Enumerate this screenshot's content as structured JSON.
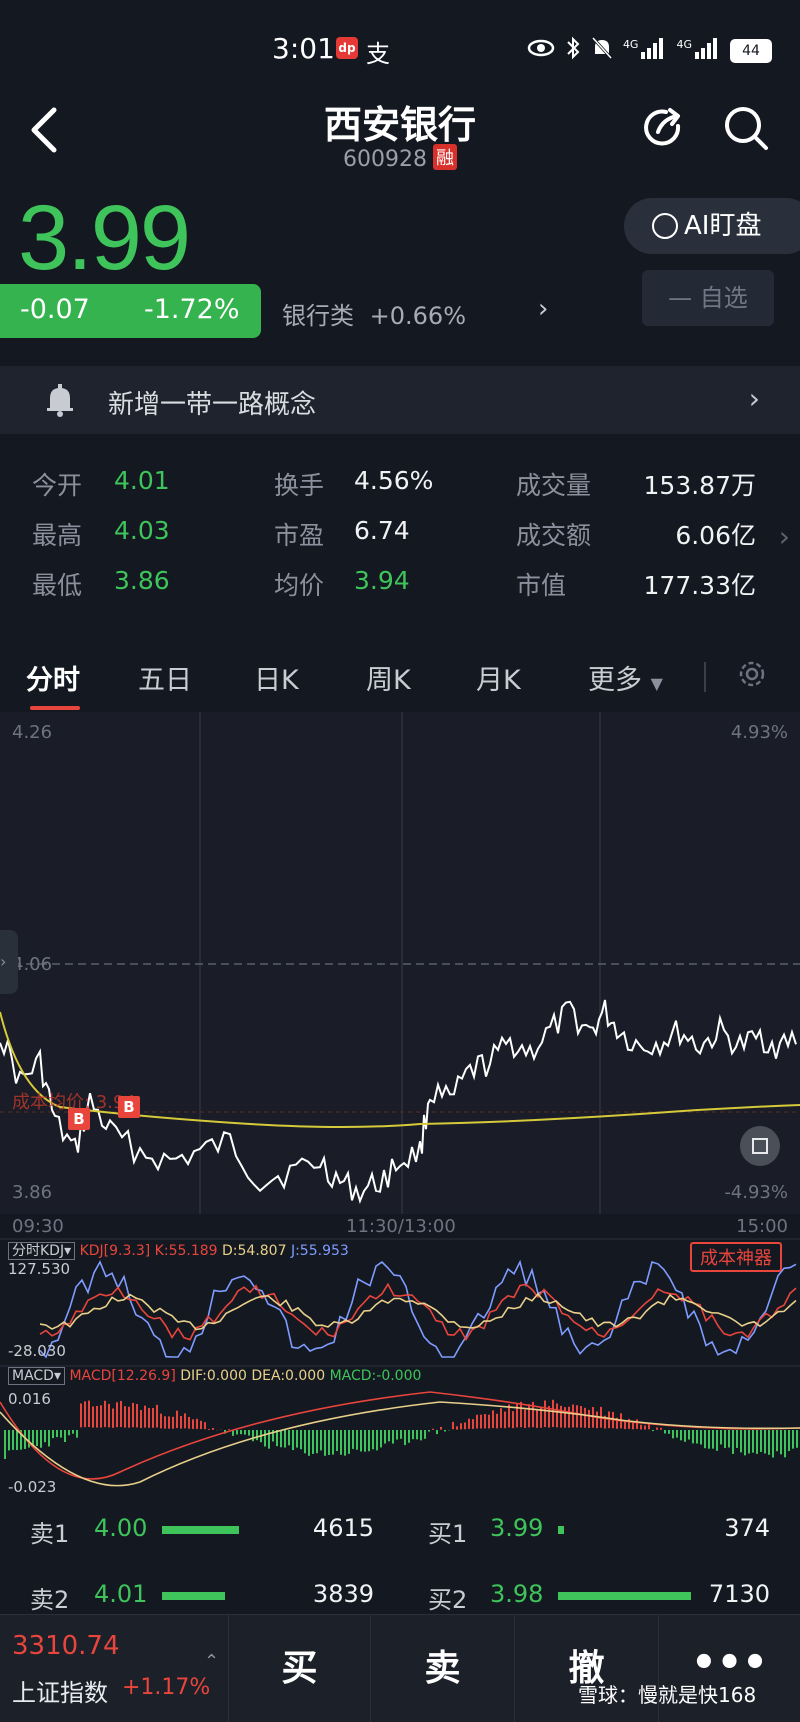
{
  "status": {
    "time": "3:01",
    "app_badge": "dp",
    "alipay": "支",
    "network1": "4G",
    "network2": "4G",
    "battery": "44"
  },
  "header": {
    "title": "西安银行",
    "code": "600928",
    "margin_badge": "融"
  },
  "quote": {
    "price": "3.99",
    "change": "-0.07",
    "change_pct": "-1.72%",
    "sector_name": "银行类",
    "sector_pct": "+0.66%",
    "ai_label": "AI盯盘",
    "watch_label": "— 自选"
  },
  "notice": {
    "text": "新增一带一路概念"
  },
  "stats": {
    "open_label": "今开",
    "open": "4.01",
    "high_label": "最高",
    "high": "4.03",
    "low_label": "最低",
    "low": "3.86",
    "turnover_label": "换手",
    "turnover": "4.56%",
    "pe_label": "市盈",
    "pe": "6.74",
    "avg_label": "均价",
    "avg": "3.94",
    "volume_label": "成交量",
    "volume": "153.87万",
    "amount_label": "成交额",
    "amount": "6.06亿",
    "mktcap_label": "市值",
    "mktcap": "177.33亿"
  },
  "tabs": [
    "分时",
    "五日",
    "日K",
    "周K",
    "月K",
    "更多"
  ],
  "chart": {
    "y_top": "4.26",
    "y_mid": "4.06",
    "y_bottom": "3.86",
    "pct_top": "4.93%",
    "pct_bottom": "-4.93%",
    "avg_cost_label": "成本均价: 3.94",
    "t_start": "09:30",
    "t_mid": "11:30/13:00",
    "t_end": "15:00",
    "buy_marker": "B"
  },
  "kdj": {
    "selector": "分时KDJ",
    "params": "KDJ[9.3.3]",
    "k": "K:55.189",
    "d": "D:54.807",
    "j": "J:55.953",
    "max": "127.530",
    "min": "-28.030",
    "badge": "成本神器"
  },
  "macd": {
    "selector": "MACD",
    "params": "MACD[12.26.9]",
    "dif": "DIF:0.000",
    "dea": "DEA:0.000",
    "macd": "MACD:-0.000",
    "max": "0.016",
    "min": "-0.023"
  },
  "orderbook": {
    "sell1_label": "卖1",
    "sell1_price": "4.00",
    "sell1_vol": "4615",
    "sell2_label": "卖2",
    "sell2_price": "4.01",
    "sell2_vol": "3839",
    "buy1_label": "买1",
    "buy1_price": "3.99",
    "buy1_vol": "374",
    "buy2_label": "买2",
    "buy2_price": "3.98",
    "buy2_vol": "7130",
    "sell1_level": 0.55,
    "sell2_level": 0.45,
    "buy1_level": 0.04,
    "buy2_level": 0.95
  },
  "bottombar": {
    "index_value": "3310.74",
    "index_name": "上证指数",
    "index_pct": "+1.17%",
    "buy_label": "买",
    "sell_label": "卖",
    "cancel_label": "撤",
    "watermark": "雪球：慢就是快168"
  },
  "colors": {
    "up": "#e8453c",
    "down": "#3ec45a",
    "avg_line": "#d6c93a",
    "price_line": "#ffffff"
  }
}
